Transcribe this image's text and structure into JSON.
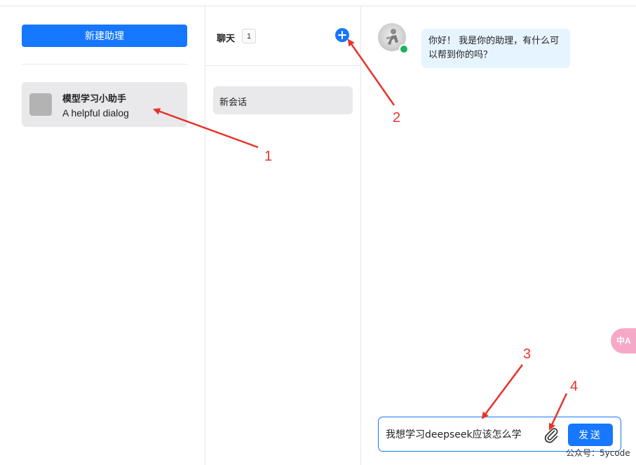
{
  "assistants_panel": {
    "new_button_label": "新建助理",
    "assistants": [
      {
        "name": "模型学习小助手",
        "description": "A helpful dialog"
      }
    ]
  },
  "chat_panel": {
    "title": "聊天",
    "count": "1",
    "add_icon": "plus-circle-icon",
    "conversations": [
      {
        "label": "新会话"
      }
    ]
  },
  "conversation": {
    "messages": [
      {
        "role": "assistant",
        "text": "你好！ 我是你的助理，有什么可以帮到你的吗？"
      }
    ],
    "input_value": "我想学习deepseek应该怎么学",
    "attach_icon": "paperclip-icon",
    "send_label": "发送"
  },
  "annotations": [
    "1",
    "2",
    "3",
    "4"
  ],
  "watermark": "公众号：5ycode",
  "translate_badge": "中A",
  "colors": {
    "accent": "#1677ff",
    "annotation_red": "#e8322a",
    "online_green": "#19b35a",
    "bubble_bg": "#e6f4ff"
  }
}
